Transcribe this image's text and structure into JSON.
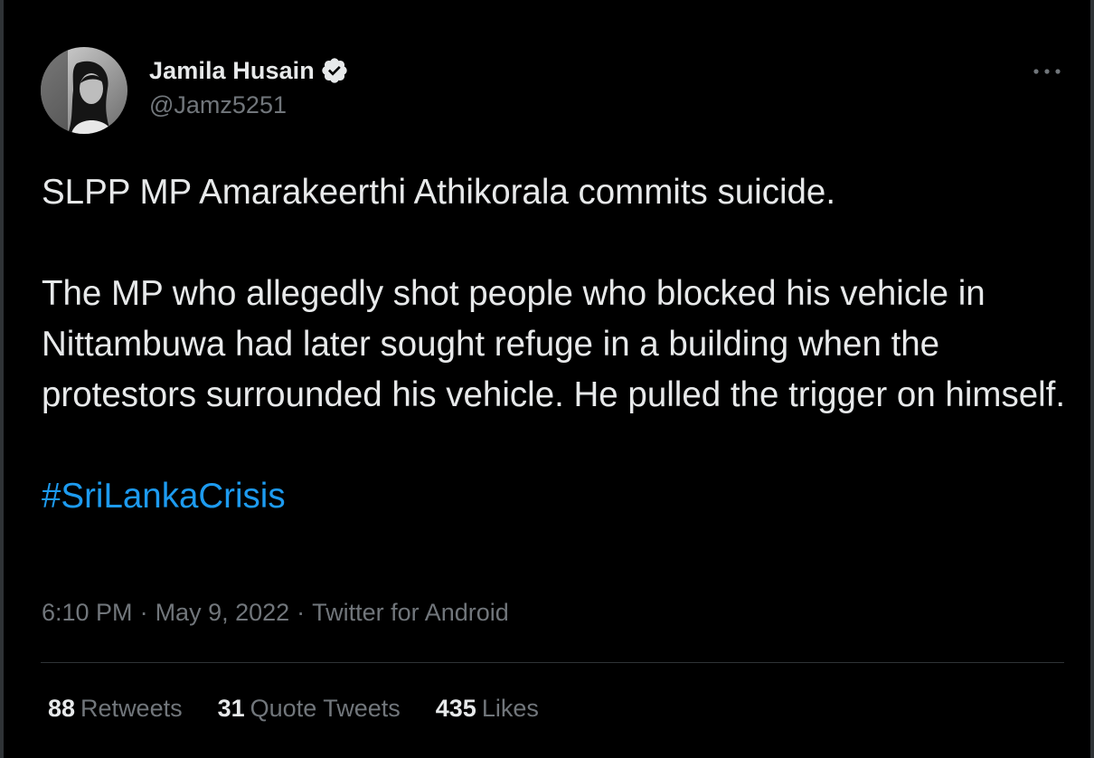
{
  "author": {
    "name": "Jamila Husain",
    "handle": "@Jamz5251",
    "verified": true
  },
  "tweet": {
    "paragraph1": "SLPP MP Amarakeerthi Athikorala commits suicide.",
    "paragraph2": "The MP who allegedly shot people who blocked his vehicle in Nittambuwa had later sought refuge in a building when the protestors surrounded his vehicle. He pulled the trigger on himself.",
    "hashtag": "#SriLankaCrisis"
  },
  "meta": {
    "time": "6:10 PM",
    "separator": "·",
    "date": "May 9, 2022",
    "source": "Twitter for Android"
  },
  "stats": {
    "retweets_count": "88",
    "retweets_label": "Retweets",
    "quotes_count": "31",
    "quotes_label": "Quote Tweets",
    "likes_count": "435",
    "likes_label": "Likes"
  },
  "icons": {
    "verified": "verified-badge-icon",
    "more": "more-options-icon"
  },
  "colors": {
    "background": "#000000",
    "text": "#e7e9ea",
    "secondary": "#71767b",
    "link": "#1d9bf0",
    "divider": "#2f3336"
  }
}
